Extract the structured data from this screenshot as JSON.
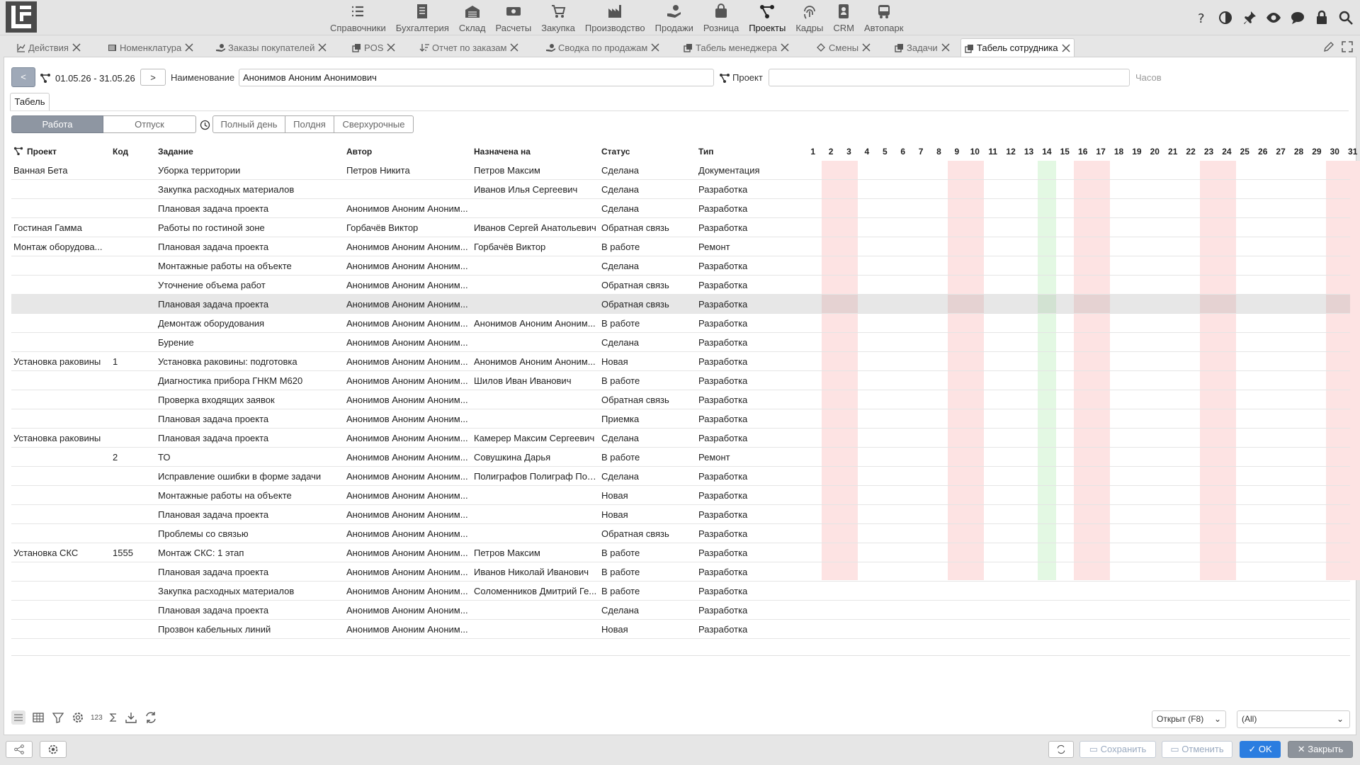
{
  "nav": [
    {
      "label": "Справочники",
      "icon": "list-icon"
    },
    {
      "label": "Бухгалтерия",
      "icon": "document-icon"
    },
    {
      "label": "Склад",
      "icon": "warehouse-icon"
    },
    {
      "label": "Расчеты",
      "icon": "money-icon"
    },
    {
      "label": "Закупка",
      "icon": "cart-icon"
    },
    {
      "label": "Производство",
      "icon": "factory-icon"
    },
    {
      "label": "Продажи",
      "icon": "hand-icon"
    },
    {
      "label": "Розница",
      "icon": "bag-icon"
    },
    {
      "label": "Проекты",
      "icon": "projects-icon",
      "active": true
    },
    {
      "label": "Кадры",
      "icon": "fingerprint-icon"
    },
    {
      "label": "CRM",
      "icon": "contact-card-icon"
    },
    {
      "label": "Автопарк",
      "icon": "bus-icon"
    }
  ],
  "tabs": [
    {
      "label": "Действия",
      "icon": "chart-icon"
    },
    {
      "label": "Номенклатура",
      "icon": "barcode-icon"
    },
    {
      "label": "Заказы покупателей",
      "icon": "hand-icon"
    },
    {
      "label": "POS",
      "icon": "copy-icon"
    },
    {
      "label": "Отчет по заказам",
      "icon": "sort-icon"
    },
    {
      "label": "Сводка по продажам",
      "icon": "hand-icon"
    },
    {
      "label": "Табель менеджера",
      "icon": "copy-icon"
    },
    {
      "label": "Смены",
      "icon": "diamond-icon"
    },
    {
      "label": "Задачи",
      "icon": "copy-icon"
    },
    {
      "label": "Табель сотрудника",
      "icon": "copy-icon",
      "active": true
    }
  ],
  "filters": {
    "prev_label": "<",
    "next_label": ">",
    "date_range": "01.05.26 - 31.05.26",
    "name_label": "Наименование",
    "name_value": "Анонимов Аноним Анонимович",
    "project_label": "Проект",
    "project_value": "",
    "hours_label": "Часов"
  },
  "subtab": "Табель",
  "mode_buttons": [
    "Работа",
    "Отпуск"
  ],
  "time_buttons": [
    "Полный день",
    "Полдня",
    "Сверхурочные"
  ],
  "columns": {
    "project": "Проект",
    "code": "Код",
    "task": "Задание",
    "author": "Автор",
    "assigned": "Назначена на",
    "status": "Статус",
    "type": "Тип"
  },
  "days": [
    "1",
    "2",
    "3",
    "4",
    "5",
    "6",
    "7",
    "8",
    "9",
    "10",
    "11",
    "12",
    "13",
    "14",
    "15",
    "16",
    "17",
    "18",
    "19",
    "20",
    "21",
    "22",
    "23",
    "24",
    "25",
    "26",
    "27",
    "28",
    "29",
    "30",
    "31"
  ],
  "weekend_days": [
    2,
    3,
    9,
    10,
    16,
    17,
    23,
    24,
    30,
    31
  ],
  "today_day": 14,
  "colors": {
    "weekend": "#fde3e3",
    "today": "#e3f8e3",
    "accent": "#2b7de0"
  },
  "rows": [
    {
      "project": "Ванная Бета",
      "code": "",
      "task": "Уборка территории",
      "author": "Петров Никита",
      "assigned": "Петров Максим",
      "status": "Сделана",
      "type": "Документация"
    },
    {
      "project": "",
      "code": "",
      "task": "Закупка расходных материалов",
      "author": "",
      "assigned": "Иванов Илья Сергеевич",
      "status": "Сделана",
      "type": "Разработка"
    },
    {
      "project": "",
      "code": "",
      "task": "Плановая задача проекта",
      "author": "Анонимов Аноним Аноним...",
      "assigned": "",
      "status": "Сделана",
      "type": "Разработка"
    },
    {
      "project": "Гостиная Гамма",
      "code": "",
      "task": "Работы по гостиной зоне",
      "author": "Горбачёв Виктор",
      "assigned": "Иванов Сергей Анатольевич",
      "status": "Обратная связь",
      "type": "Разработка"
    },
    {
      "project": "Монтаж оборудова...",
      "code": "",
      "task": "Плановая задача проекта",
      "author": "Анонимов Аноним Аноним...",
      "assigned": "Горбачёв Виктор",
      "status": "В работе",
      "type": "Ремонт"
    },
    {
      "project": "",
      "code": "",
      "task": "Монтажные работы на объекте",
      "author": "Анонимов Аноним Аноним...",
      "assigned": "",
      "status": "Сделана",
      "type": "Разработка"
    },
    {
      "project": "",
      "code": "",
      "task": "Уточнение объема работ",
      "author": "Анонимов Аноним Аноним...",
      "assigned": "",
      "status": "Обратная связь",
      "type": "Разработка"
    },
    {
      "project": "",
      "code": "",
      "task": "Плановая задача проекта",
      "author": "Анонимов Аноним Аноним...",
      "assigned": "",
      "status": "Обратная связь",
      "type": "Разработка",
      "selected": true
    },
    {
      "project": "",
      "code": "",
      "task": "Демонтаж оборудования",
      "author": "Анонимов Аноним Аноним...",
      "assigned": "Анонимов Аноним Аноним...",
      "status": "В работе",
      "type": "Разработка"
    },
    {
      "project": "",
      "code": "",
      "task": "Бурение",
      "author": "Анонимов Аноним Аноним...",
      "assigned": "",
      "status": "Сделана",
      "type": "Разработка"
    },
    {
      "project": "Установка раковины",
      "code": "1",
      "task": "Установка раковины: подготовка",
      "author": "Анонимов Аноним Аноним...",
      "assigned": "Анонимов Аноним Аноним...",
      "status": "Новая",
      "type": "Разработка"
    },
    {
      "project": "",
      "code": "",
      "task": "Диагностика прибора ГНКМ М620",
      "author": "Анонимов Аноним Аноним...",
      "assigned": "Шилов Иван Иванович",
      "status": "В работе",
      "type": "Разработка"
    },
    {
      "project": "",
      "code": "",
      "task": "Проверка входящих заявок",
      "author": "Анонимов Аноним Аноним...",
      "assigned": "",
      "status": "Обратная связь",
      "type": "Разработка"
    },
    {
      "project": "",
      "code": "",
      "task": "Плановая задача проекта",
      "author": "Анонимов Аноним Аноним...",
      "assigned": "",
      "status": "Приемка",
      "type": "Разработка"
    },
    {
      "project": "Установка раковины",
      "code": "",
      "task": "Плановая задача проекта",
      "author": "Анонимов Аноним Аноним...",
      "assigned": "Камерер Максим Сергеевич",
      "status": "Сделана",
      "type": "Разработка"
    },
    {
      "project": "",
      "code": "2",
      "task": "ТО",
      "author": "Анонимов Аноним Аноним...",
      "assigned": "Совушкина Дарья",
      "status": "В работе",
      "type": "Ремонт"
    },
    {
      "project": "",
      "code": "",
      "task": "Исправление ошибки в форме задачи",
      "author": "Анонимов Аноним Аноним...",
      "assigned": "Полиграфов Полиграф Пол...",
      "status": "Сделана",
      "type": "Разработка"
    },
    {
      "project": "",
      "code": "",
      "task": "Монтажные работы на объекте",
      "author": "Анонимов Аноним Аноним...",
      "assigned": "",
      "status": "Новая",
      "type": "Разработка"
    },
    {
      "project": "",
      "code": "",
      "task": "Плановая задача проекта",
      "author": "Анонимов Аноним Аноним...",
      "assigned": "",
      "status": "Новая",
      "type": "Разработка"
    },
    {
      "project": "",
      "code": "",
      "task": "Проблемы со связью",
      "author": "Анонимов Аноним Аноним...",
      "assigned": "",
      "status": "Обратная связь",
      "type": "Разработка"
    },
    {
      "project": "Установка СКС",
      "code": "1555",
      "task": "Монтаж СКС: 1 этап",
      "author": "Анонимов Аноним Аноним...",
      "assigned": "Петров Максим",
      "status": "В работе",
      "type": "Разработка"
    },
    {
      "project": "",
      "code": "",
      "task": "Плановая задача проекта",
      "author": "Анонимов Аноним Аноним...",
      "assigned": "Иванов Николай Иванович",
      "status": "В работе",
      "type": "Разработка"
    },
    {
      "project": "",
      "code": "",
      "task": "Закупка расходных материалов",
      "author": "Анонимов Аноним Аноним...",
      "assigned": "Соломенников Дмитрий Ге...",
      "status": "В работе",
      "type": "Разработка"
    },
    {
      "project": "",
      "code": "",
      "task": "Плановая задача проекта",
      "author": "Анонимов Аноним Аноним...",
      "assigned": "",
      "status": "Сделана",
      "type": "Разработка"
    },
    {
      "project": "",
      "code": "",
      "task": "Прозвон кабельных линий",
      "author": "Анонимов Аноним Аноним...",
      "assigned": "",
      "status": "Новая",
      "type": "Разработка"
    }
  ],
  "footer": {
    "status_select": "Открыт (F8)",
    "filter_select": "(All)",
    "count_label": "123"
  },
  "buttons": {
    "save": "Сохранить",
    "cancel": "Отменить",
    "ok": "OK",
    "close": "Закрыть"
  }
}
